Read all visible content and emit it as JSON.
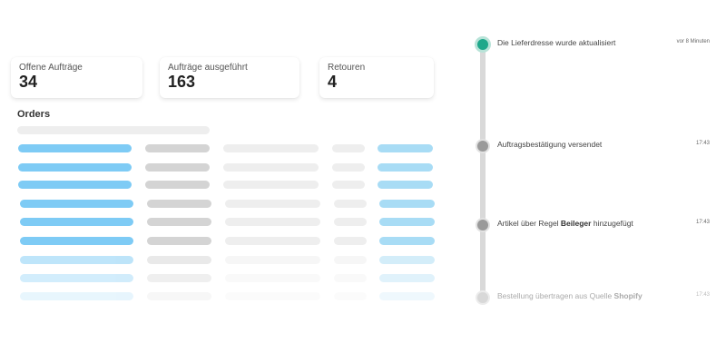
{
  "stats": [
    {
      "label": "Offene Aufträge",
      "value": "34"
    },
    {
      "label": "Aufträge ausgeführt",
      "value": "163"
    },
    {
      "label": "Retouren",
      "value": "4"
    }
  ],
  "orders": {
    "title": "Orders"
  },
  "timeline": {
    "events": [
      {
        "text": "Die Lieferdresse wurde aktualisiert",
        "bold": "",
        "suffix": "",
        "time": "vor 8 Minuten"
      },
      {
        "text": "Auftragsbestätigung versendet",
        "bold": "",
        "suffix": "",
        "time": "17:43"
      },
      {
        "text": "Artikel über Regel ",
        "bold": "Beileger",
        "suffix": " hinzugefügt",
        "time": "17:43"
      },
      {
        "text": "Bestellung übertragen aus Quelle ",
        "bold": "Shopify",
        "suffix": "",
        "time": "17:43"
      }
    ]
  },
  "colors": {
    "accent": "#1fa88b",
    "bar_blue": "#7ecbf5",
    "bar_gray": "#d4d4d4",
    "bar_light": "#eeeeee",
    "bar_lightblue": "#a8dcf5"
  }
}
